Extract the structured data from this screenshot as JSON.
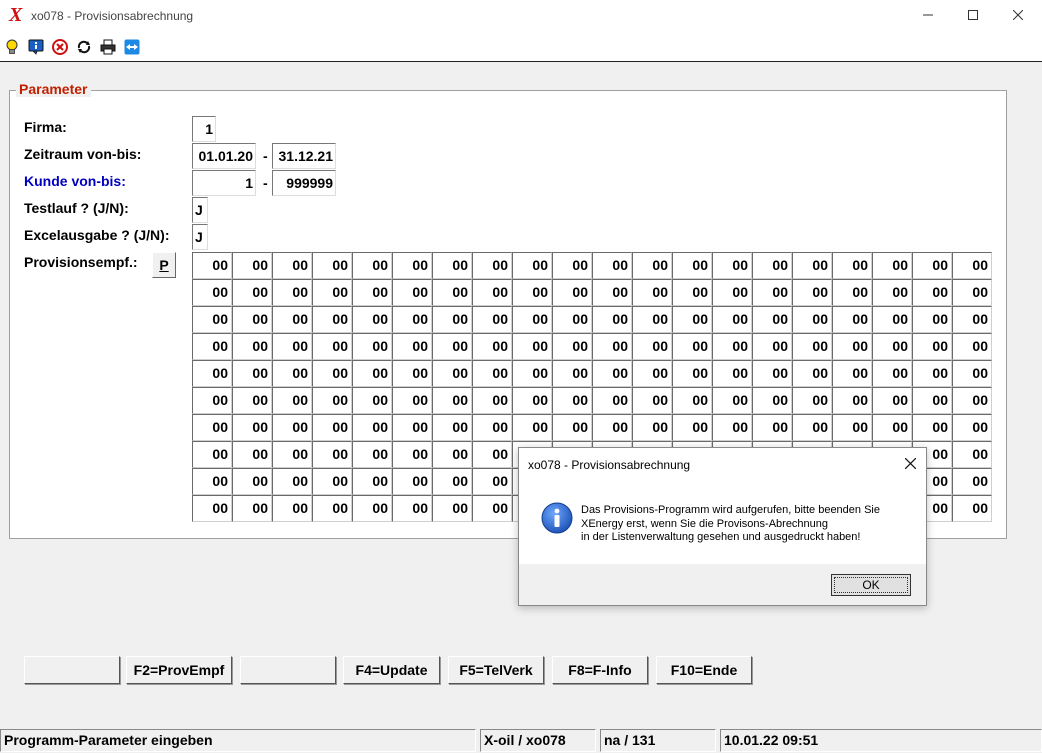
{
  "window": {
    "logo": "X",
    "title": "xo078 - Provisionsabrechnung"
  },
  "toolbar": {
    "icons": [
      "lightbulb-icon",
      "info-icon",
      "stop-icon",
      "refresh-icon",
      "printer-icon",
      "remote-icon"
    ]
  },
  "group": {
    "legend": "Parameter"
  },
  "form": {
    "firma_label": "Firma:",
    "firma_value": "1",
    "zeitraum_label": "Zeitraum von-bis:",
    "zeitraum_von": "01.01.20",
    "zeitraum_bis": "31.12.21",
    "kunde_label": "Kunde von-bis:",
    "kunde_von": "1",
    "kunde_bis": "999999",
    "testlauf_label": "Testlauf ? (J/N):",
    "testlauf_value": "J",
    "excel_label": "Excelausgabe ? (J/N):",
    "excel_value": "J",
    "prov_label": "Provisionsempf.:",
    "prov_button": "P",
    "separator": "-"
  },
  "grid": {
    "rows": 10,
    "cols": 20,
    "cell_value": "00"
  },
  "function_keys": [
    "",
    "F2=ProvEmpf",
    "",
    "F4=Update",
    "F5=TelVerk",
    "F8=F-Info",
    "F10=Ende"
  ],
  "statusbar": {
    "message": "Programm-Parameter eingeben",
    "program": "X-oil / xo078",
    "user": "na / 131",
    "datetime": "10.01.22 09:51"
  },
  "dialog": {
    "title": "xo078 - Provisionsabrechnung",
    "lines": [
      "Das Provisions-Programm wird aufgerufen, bitte beenden Sie",
      "XEnergy erst, wenn Sie die Provisons-Abrechnung",
      "in der Listenverwaltung gesehen und  ausgedruckt haben!"
    ],
    "ok_label": "OK"
  },
  "colors": {
    "legend": "#c02000",
    "kunde_label": "#0000c0",
    "logo": "#d01010",
    "info_icon": "#1a5fc4"
  }
}
